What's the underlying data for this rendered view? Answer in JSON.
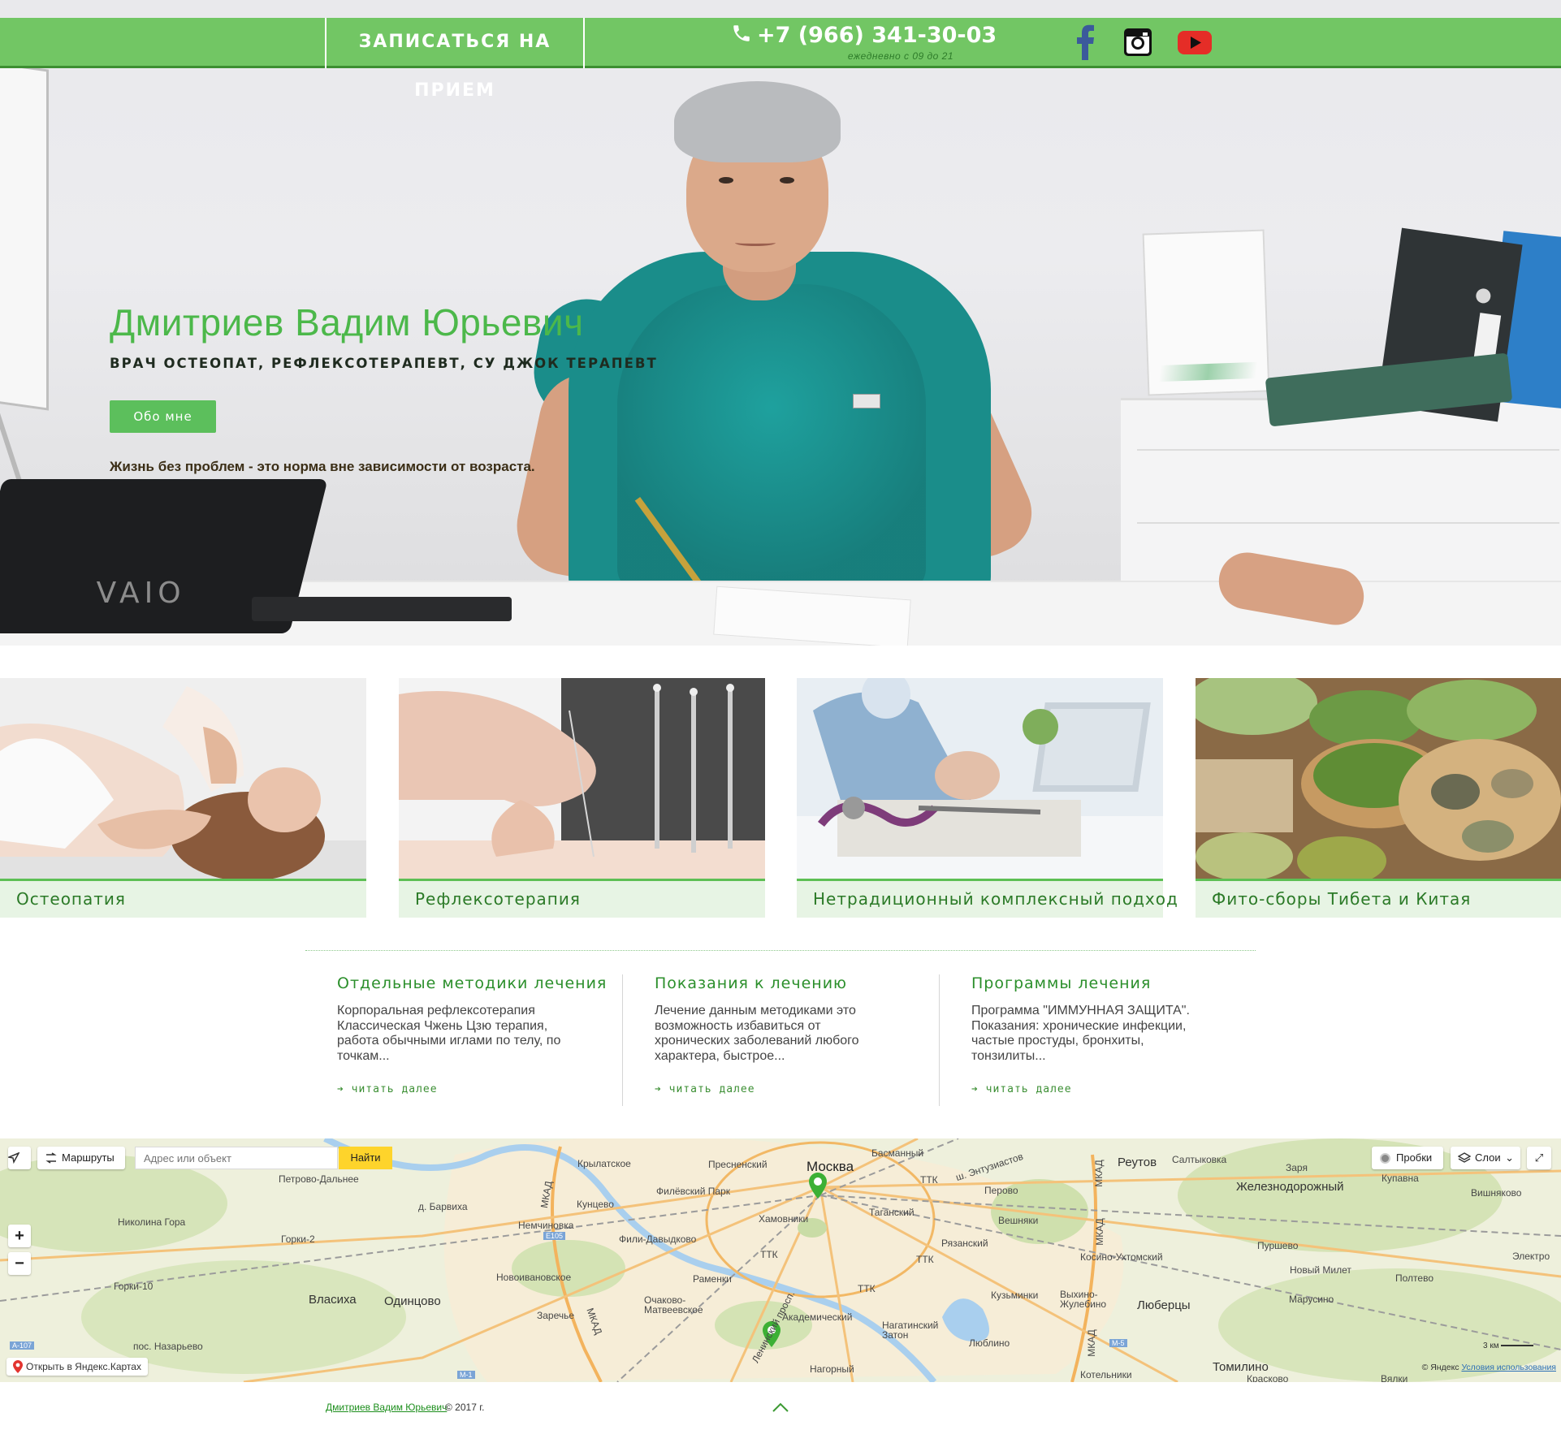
{
  "topbar": {
    "book_label": "ЗАПИСАТЬСЯ НА ПРИЕМ",
    "phone": "+7 (966) 341-30-03",
    "hours": "ежедневно с 09 до 21",
    "social": [
      "facebook-icon",
      "instagram-icon",
      "youtube-icon"
    ]
  },
  "hero": {
    "name": "Дмитриев Вадим Юрьевич",
    "title": "ВРАЧ ОСТЕОПАТ, РЕФЛЕКСОТЕРАПЕВТ, СУ ДЖОК ТЕРАПЕВТ",
    "button": "Обо мне",
    "slogan": "Жизнь без проблем - это норма вне зависимости от возраста.",
    "laptop_brand": "VAIO"
  },
  "services": [
    {
      "label": "Остеопатия"
    },
    {
      "label": "Рефлексотерапия"
    },
    {
      "label": "Нетрадиционный комплексный подход"
    },
    {
      "label": "Фито-сборы Тибета и Китая"
    }
  ],
  "info": [
    {
      "title": "Отдельные методики лечения",
      "text": "Корпоральная рефлексотерапия Классическая Чжень Цзю терапия, работа обычными иглами по телу, по точкам...",
      "more": "➔ читать далее"
    },
    {
      "title": "Показания к лечению",
      "text": "Лечение данным методиками это возможность избавиться от хронических заболеваний любого характера, быстрое...",
      "more": "➔ читать далее"
    },
    {
      "title": "Программы лечения",
      "text": "Программа \"ИММУННАЯ ЗАЩИТА\". Показания: хронические инфекции, частые простуды, бронхиты, тонзилиты...",
      "more": "➔ читать далее"
    }
  ],
  "map": {
    "routes": "Маршруты",
    "search_placeholder": "Адрес или объект",
    "find": "Найти",
    "traffic": "Пробки",
    "layers": "Слои",
    "open_in": "Открыть в Яндекс.Картах",
    "scale": "3 км",
    "copyright_brand": "© Яндекс",
    "terms": "Условия использования",
    "labels": {
      "moscow": "Москва",
      "reutov": "Реутов",
      "zheleznodorozhny": "Железнодорожный",
      "odintsovo": "Одинцово",
      "lyubertsy": "Люберцы",
      "saltykovka": "Салтыковка",
      "zarya": "Заря",
      "kupavna": "Купавна",
      "vishnyakovo": "Вишняково",
      "krylatskoe": "Крылатское",
      "presnensky": "Пресненский",
      "basmanny": "Басманный",
      "entuziastov": "ш. Энтузиастов",
      "perovo": "Перово",
      "petrovo_dalnee": "Петрово-Дальнее",
      "barvikha": "д. Барвиха",
      "kuntsevo": "Кунцево",
      "filevsky": "Филёвский Парк",
      "khamovniki": "Хамовники",
      "tagansky": "Таганский",
      "veshnyaki": "Вешняки",
      "nikolina_gora": "Николина Гора",
      "gorki2": "Горки-2",
      "nemchinovka": "Немчиновка",
      "fili": "Фили-Давыдково",
      "ryazansky": "Рязанский",
      "kosino": "Косино-Ухтомский",
      "purshevo": "Пуршево",
      "elektro": "Электро",
      "novy_milet": "Новый Милет",
      "poltevo": "Полтево",
      "gorki10": "Горки-10",
      "novoivanovskoe": "Новоивановское",
      "ramenki": "Раменки",
      "kuzminki": "Кузьминки",
      "vykhino": "Выхино-Жулебино",
      "marusino": "Марусино",
      "zarechye": "Заречье",
      "ochakovo": "Очаково-Матвеевское",
      "akademichesky": "Академический",
      "nagatinsky": "Нагатинский Затон",
      "vlasikha": "Власиха",
      "nazarevo": "пос. Назарьево",
      "leninsky": "Ленинский просп.",
      "nagorny": "Нагорный",
      "lyublino": "Люблино",
      "tomilino": "Томилино",
      "kotelniki": "Котельники",
      "kraskovo": "Красково",
      "vyalki": "Вялки",
      "ttk": "ТТК",
      "mkad": "МКАД",
      "e105": "E105",
      "m1": "М-1",
      "m5": "М-5",
      "a107": "А-107"
    }
  },
  "footer": {
    "author": "Дмитриев Вадим Юрьевич",
    "copyright": "© 2017 г."
  },
  "colors": {
    "accent": "#72c664",
    "accent_dark": "#3d8f31",
    "name_green": "#4cb84a",
    "card_bg": "#e7f4e4"
  }
}
